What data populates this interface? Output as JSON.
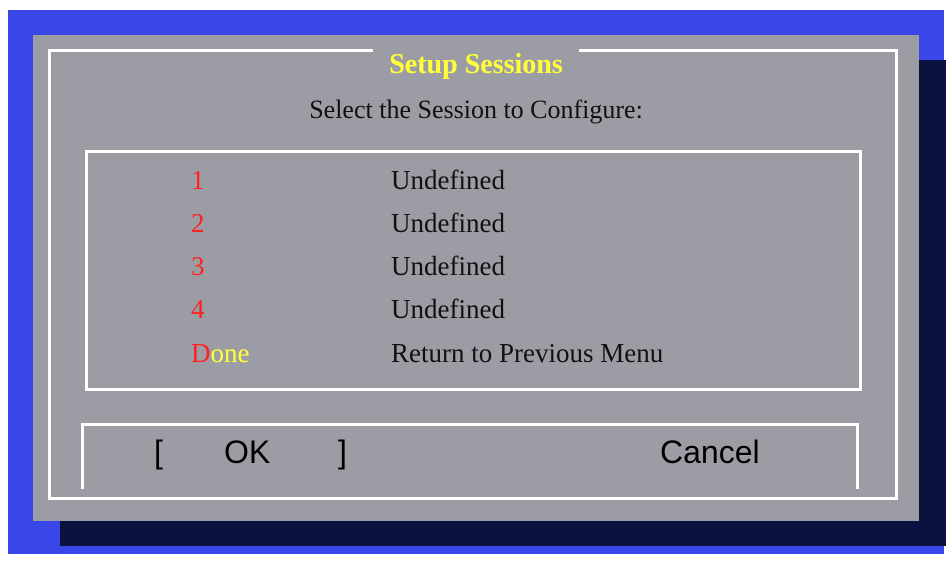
{
  "dialog": {
    "title": "Setup Sessions",
    "prompt": "Select the Session to Configure:",
    "items": [
      {
        "key": "1",
        "key_rest": "",
        "description": "Undefined"
      },
      {
        "key": "2",
        "key_rest": "",
        "description": "Undefined"
      },
      {
        "key": "3",
        "key_rest": "",
        "description": "Undefined"
      },
      {
        "key": "4",
        "key_rest": "",
        "description": "Undefined"
      },
      {
        "key": "D",
        "key_rest": "one",
        "description": "Return to Previous Menu"
      }
    ],
    "buttons": {
      "ok_open": "[",
      "ok_label": "OK",
      "ok_close": "]",
      "cancel_label": "Cancel"
    }
  },
  "colors": {
    "background": "#3a47e8",
    "shadow": "#0c1240",
    "dialog": "#9c9ca4",
    "title": "#ffff3c",
    "hotkey": "#ff2020"
  }
}
